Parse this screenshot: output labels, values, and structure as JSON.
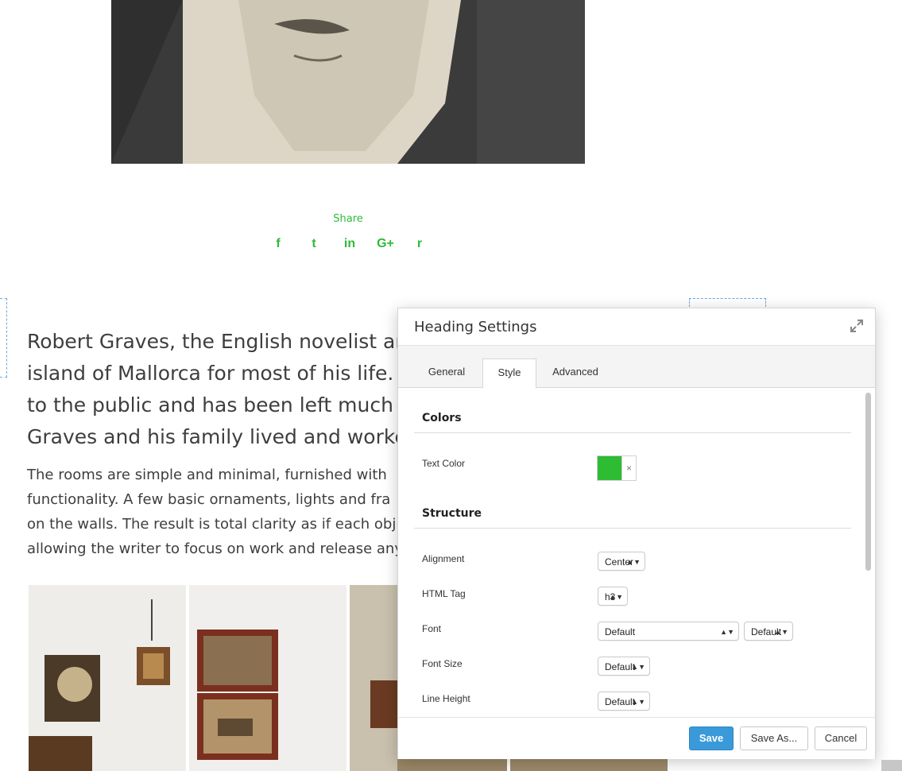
{
  "share": {
    "title": "Share",
    "icons": [
      "facebook-icon",
      "twitter-icon",
      "linkedin-icon",
      "google-plus-icon",
      "reddit-icon"
    ],
    "glyphs": [
      "f",
      "t",
      "in",
      "G+",
      "r"
    ],
    "color": "#2fba39"
  },
  "article": {
    "heading_lines": [
      "Robert Graves, the English novelist and",
      "island of Mallorca for most of his life. H",
      "to the public and has been left much th",
      "Graves and his family lived and worked"
    ],
    "body_lines": [
      "The rooms are simple and minimal, furnished with",
      "functionality. A few basic ornaments, lights and fra",
      "on the walls. The result is total clarity as if each obj",
      "allowing the writer to focus on work and release any"
    ]
  },
  "modal": {
    "title": "Heading Settings",
    "tabs": [
      "General",
      "Style",
      "Advanced"
    ],
    "active_tab": "Style",
    "sections": {
      "colors": {
        "title": "Colors",
        "text_color_label": "Text Color",
        "text_color_value": "#2ebc33",
        "clear_label": "×"
      },
      "structure": {
        "title": "Structure",
        "alignment_label": "Alignment",
        "alignment_value": "Center",
        "html_tag_label": "HTML Tag",
        "html_tag_value": "h3",
        "font_label": "Font",
        "font_value": "Default",
        "font_weight_value": "Default",
        "font_size_label": "Font Size",
        "font_size_value": "Default",
        "line_height_label": "Line Height",
        "line_height_value": "Default"
      }
    },
    "footer": {
      "save_label": "Save",
      "save_as_label": "Save As...",
      "cancel_label": "Cancel"
    }
  },
  "colors": {
    "accent_green": "#2fba39",
    "primary_button": "#3a9ad9"
  }
}
